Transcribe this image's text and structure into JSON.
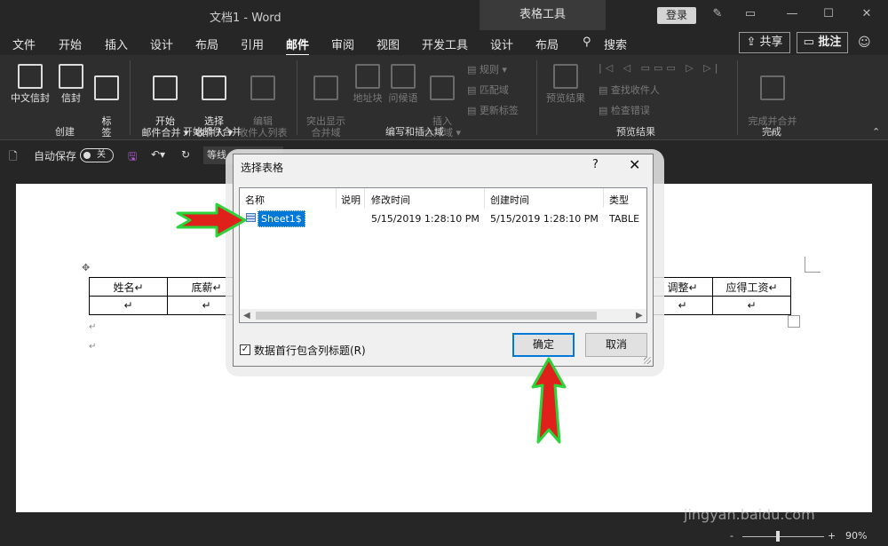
{
  "titlebar": {
    "title": "文档1 - Word",
    "tools_tab": "表格工具",
    "login": "登录",
    "controls": [
      "pen-icon",
      "restore-ribbon-icon",
      "minimize-icon",
      "maximize-icon",
      "close-icon"
    ]
  },
  "menu": {
    "tabs": [
      "文件",
      "开始",
      "插入",
      "设计",
      "布局",
      "引用",
      "邮件",
      "审阅",
      "视图",
      "开发工具",
      "设计",
      "布局",
      "搜索"
    ],
    "active_index": 6,
    "share": "共享",
    "comment": "批注"
  },
  "ribbon": {
    "groups": [
      {
        "label": "创建",
        "buttons": [
          "中文信封",
          "信封",
          "标\n签"
        ]
      },
      {
        "label": "开始邮件合并",
        "buttons": [
          "开始\n邮件合并 ▾",
          "选择\n收件人 ▾",
          "编辑\n收件人列表"
        ]
      },
      {
        "label": "编写和插入域",
        "buttons": [
          "突出显示\n合并域",
          "地址块",
          "问候语",
          "插入\n合并域 ▾"
        ],
        "small": [
          "规则 ▾",
          "匹配域",
          "更新标签"
        ]
      },
      {
        "label": "预览结果",
        "buttons": [
          "预览结果"
        ],
        "small": [
          "查找收件人",
          "检查错误"
        ]
      },
      {
        "label": "完成",
        "buttons": [
          "完成并合并\n▾"
        ]
      }
    ]
  },
  "qat": {
    "autosave_label": "自动保存",
    "autosave_state": "关",
    "style_value": "等线"
  },
  "document": {
    "table_headers": [
      "姓名",
      "底薪",
      "调整",
      "应得工资"
    ]
  },
  "dialog": {
    "title": "选择表格",
    "help": "?",
    "columns": [
      "名称",
      "说明",
      "修改时间",
      "创建时间",
      "类型"
    ],
    "rows": [
      {
        "name": "Sheet1$",
        "desc": "",
        "modified": "5/15/2019 1:28:10 PM",
        "created": "5/15/2019 1:28:10 PM",
        "type": "TABLE"
      }
    ],
    "checkbox_label": "数据首行包含列标题(R)",
    "checkbox_checked": true,
    "ok": "确定",
    "cancel": "取消"
  },
  "status": {
    "zoom": "90%",
    "zoom_minus": "-",
    "zoom_plus": "+"
  },
  "watermark": {
    "brand": "Baidu经验",
    "url": "jingyan.baidu.com"
  },
  "colors": {
    "background": "#262626",
    "ribbon": "#2e2e2e",
    "selection": "#0078d7",
    "arrow_fill": "#e0201a",
    "arrow_outline": "#2bd43a"
  }
}
